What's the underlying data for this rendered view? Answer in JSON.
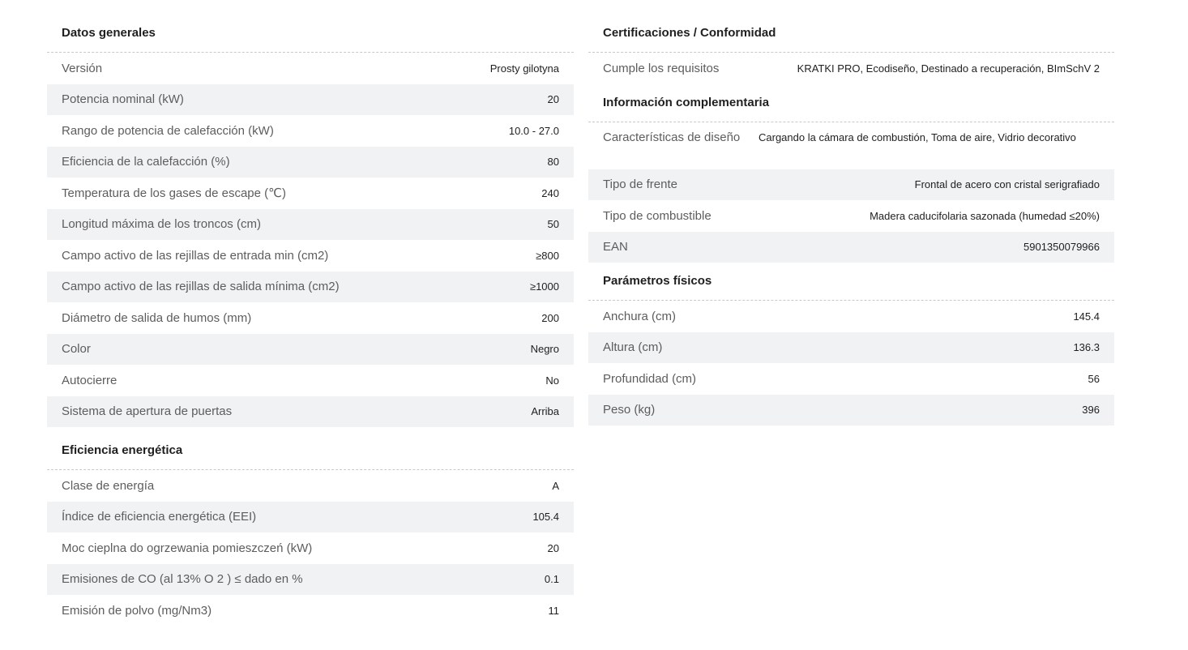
{
  "left": {
    "general": {
      "title": "Datos generales",
      "rows": [
        {
          "label": "Versión",
          "value": "Prosty gilotyna"
        },
        {
          "label": "Potencia nominal (kW)",
          "value": "20"
        },
        {
          "label": "Rango de potencia de calefacción (kW)",
          "value": "10.0 - 27.0"
        },
        {
          "label": "Eficiencia de la calefacción (%)",
          "value": "80"
        },
        {
          "label": "Temperatura de los gases de escape (℃)",
          "value": "240"
        },
        {
          "label": "Longitud máxima de los troncos (cm)",
          "value": "50"
        },
        {
          "label": "Campo activo de las rejillas de entrada min (cm2)",
          "value": "≥800"
        },
        {
          "label": "Campo activo de las rejillas de salida mínima (cm2)",
          "value": "≥1000"
        },
        {
          "label": "Diámetro de salida de humos (mm)",
          "value": "200"
        },
        {
          "label": "Color",
          "value": "Negro"
        },
        {
          "label": "Autocierre",
          "value": "No"
        },
        {
          "label": "Sistema de apertura de puertas",
          "value": "Arriba"
        }
      ]
    },
    "energy": {
      "title": "Eficiencia energética",
      "rows": [
        {
          "label": "Clase de energía",
          "value": "A"
        },
        {
          "label": "Índice de eficiencia energética (EEI)",
          "value": "105.4"
        },
        {
          "label": "Moc cieplna do ogrzewania pomieszczeń (kW)",
          "value": "20"
        },
        {
          "label": "Emisiones de CO (al 13% O 2 ) ≤ dado en %",
          "value": "0.1"
        },
        {
          "label": "Emisión de polvo (mg/Nm3)",
          "value": "11"
        }
      ]
    }
  },
  "right": {
    "certifications": {
      "title": "Certificaciones / Conformidad",
      "rows": [
        {
          "label": "Cumple los requisitos",
          "value": "KRATKI PRO, Ecodiseño, Destinado a recuperación, BImSchV 2"
        }
      ]
    },
    "complementary": {
      "title": "Información complementaria",
      "rows": [
        {
          "label": "Características de diseño",
          "value": "Cargando la cámara de combustión, Toma de aire, Vidrio decorativo"
        },
        {
          "label": "Tipo de frente",
          "value": "Frontal de acero con cristal serigrafiado"
        },
        {
          "label": "Tipo de combustible",
          "value": "Madera caducifolaria sazonada (humedad ≤20%)"
        },
        {
          "label": "EAN",
          "value": "5901350079966"
        }
      ]
    },
    "physical": {
      "title": "Parámetros físicos",
      "rows": [
        {
          "label": "Anchura (cm)",
          "value": "145.4"
        },
        {
          "label": "Altura (cm)",
          "value": "136.3"
        },
        {
          "label": "Profundidad (cm)",
          "value": "56"
        },
        {
          "label": "Peso (kg)",
          "value": "396"
        }
      ]
    }
  }
}
